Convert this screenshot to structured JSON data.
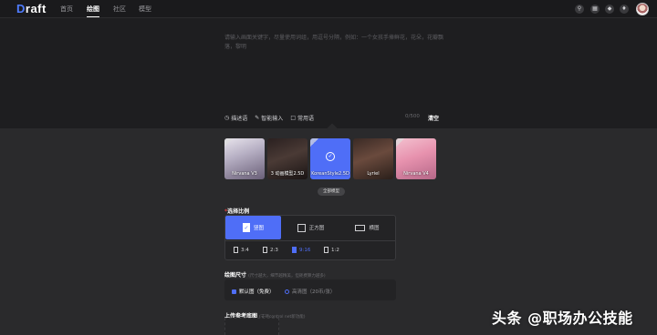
{
  "app": {
    "logo_letter": "D",
    "logo_rest": "raft"
  },
  "nav": {
    "items": [
      "首页",
      "绘图",
      "社区",
      "模型"
    ],
    "active_index": 1
  },
  "header_icons": [
    "search-icon",
    "grid-icon",
    "tag-icon",
    "bell-icon",
    "avatar"
  ],
  "prompt": {
    "placeholder": "请输入画面关键字，尽量使用词组，用逗号分隔，例如：一个女孩手捧鲜花，花朵，花瓣飘落，黎明",
    "tools": [
      "描述语",
      "智能输入",
      "常用语"
    ],
    "counter": "0/500",
    "clear_label": "清空"
  },
  "models": {
    "items": [
      {
        "label": "Nirvana V3"
      },
      {
        "label": "3 动画模型2.5D"
      },
      {
        "label": "KoreanStyle2.5D",
        "selected": true
      },
      {
        "label": "Lyriel"
      },
      {
        "label": "Nirvana V4"
      }
    ],
    "all_label": "全部模型"
  },
  "ratio_section": {
    "title": "选择比例",
    "required_mark": "*",
    "orientations": [
      "竖图",
      "正方图",
      "横图"
    ],
    "selected_orientation": 0,
    "ratios": [
      "3:4",
      "2:3",
      "9:16",
      "1:2"
    ],
    "selected_ratio": 2
  },
  "size_section": {
    "title": "绘图尺寸",
    "hint": "(尺寸越大，细节越精美，但耗费算力越多)",
    "options": [
      {
        "label": "默认图（免费）",
        "selected": true
      },
      {
        "label": "高清图（20币/张）",
        "selected": false
      }
    ]
  },
  "upload_section": {
    "title": "上传参考底图",
    "hint": "(支持control net新功能)"
  },
  "watermark": "头条 @职场办公技能",
  "colors": {
    "accent": "#4f6ef7",
    "background": "#1e1e20",
    "panel": "#2a2a2c"
  }
}
